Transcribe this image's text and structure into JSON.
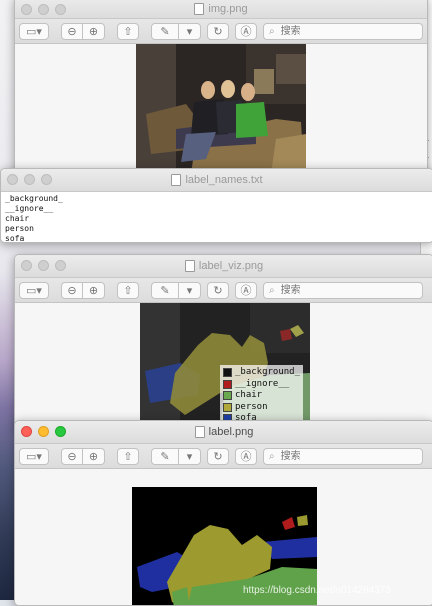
{
  "windows": {
    "img": {
      "title": "img.png"
    },
    "label_names": {
      "title": "label_names.txt",
      "lines": [
        "_background_",
        "__ignore__",
        "chair",
        "person",
        "sofa"
      ]
    },
    "label_viz": {
      "title": "label_viz.png",
      "legend": [
        {
          "label": "_background_",
          "color": "#111111"
        },
        {
          "label": "__ignore__",
          "color": "#b01c1c"
        },
        {
          "label": "chair",
          "color": "#6aa84f"
        },
        {
          "label": "person",
          "color": "#b0a83a"
        },
        {
          "label": "sofa",
          "color": "#1f3fa8"
        }
      ]
    },
    "label": {
      "title": "label.png"
    }
  },
  "toolbar": {
    "search_placeholder": "搜索",
    "sidebar_icon": "sidebar-icon",
    "zoom_out_icon": "zoom-out-icon",
    "zoom_in_icon": "zoom-in-icon",
    "share_icon": "share-icon",
    "markup_icon": "pen-icon",
    "rotate_icon": "rotate-icon",
    "annotate_icon": "annotate-icon"
  },
  "colors": {
    "chair": "#6aa84f",
    "person": "#b0a83a",
    "sofa": "#1f3fa8",
    "ignore": "#b01c1c",
    "background": "#000000"
  },
  "watermark": "https://blog.csdn.net/u014264373"
}
